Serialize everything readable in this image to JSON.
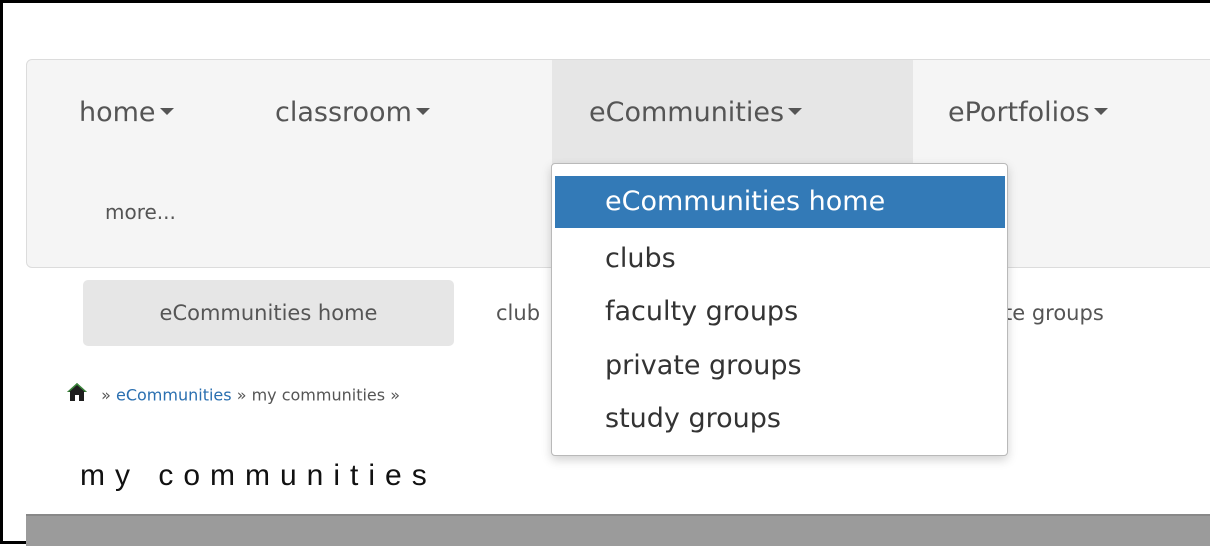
{
  "navbar": {
    "items": [
      {
        "label": "home"
      },
      {
        "label": "classroom"
      },
      {
        "label": "eCommunities"
      },
      {
        "label": "ePortfolios"
      }
    ],
    "more_label": "more..."
  },
  "subnav": {
    "items": [
      {
        "label": "eCommunities home"
      },
      {
        "label": "club"
      },
      {
        "label": "te groups"
      }
    ]
  },
  "breadcrumb": {
    "separator": "»",
    "link": "eCommunities",
    "current": "my communities »"
  },
  "page_title": "my communities",
  "dropdown": {
    "items": [
      {
        "label": "eCommunities home",
        "active": true
      },
      {
        "label": "clubs"
      },
      {
        "label": "faculty groups"
      },
      {
        "label": "private groups"
      },
      {
        "label": "study groups"
      }
    ]
  },
  "colors": {
    "accent": "#337ab7",
    "link": "#2a6fb0",
    "bottom_bar": "#9b9b9b"
  },
  "icons": {
    "home": "home-icon",
    "caret": "caret-down-icon"
  }
}
